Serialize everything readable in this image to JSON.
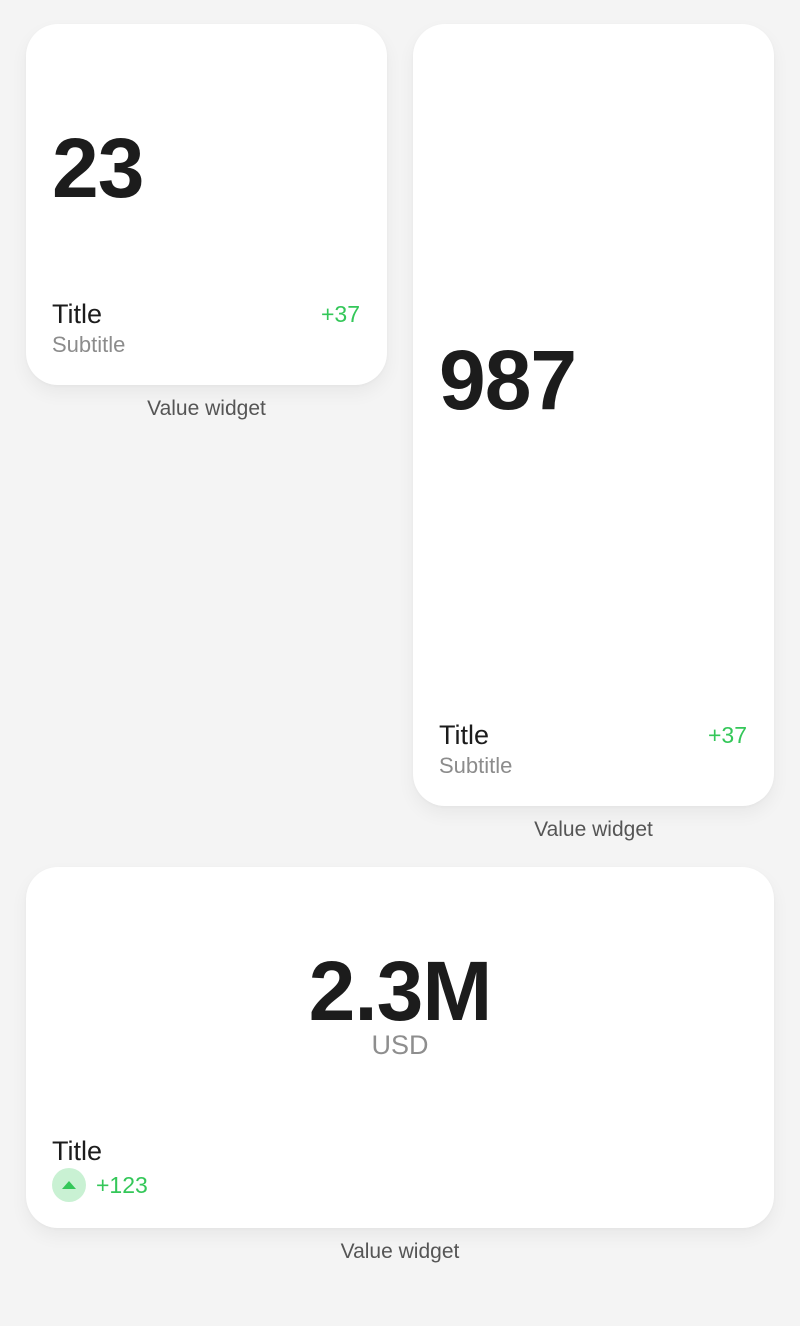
{
  "widgets": [
    {
      "value": "23",
      "title": "Title",
      "subtitle": "Subtitle",
      "delta": "+37",
      "caption": "Value widget"
    },
    {
      "value": "987",
      "title": "Title",
      "subtitle": "Subtitle",
      "delta": "+37",
      "caption": "Value widget"
    },
    {
      "value": "2.3M",
      "unit": "USD",
      "title": "Title",
      "delta": "+123",
      "trend_icon": "arrow-up-icon",
      "caption": "Value widget"
    }
  ],
  "colors": {
    "background": "#f4f4f4",
    "card": "#ffffff",
    "value": "#1c1c1c",
    "muted": "#8c8c8c",
    "positive": "#34c759",
    "positive_bg": "#c9f1d3"
  }
}
